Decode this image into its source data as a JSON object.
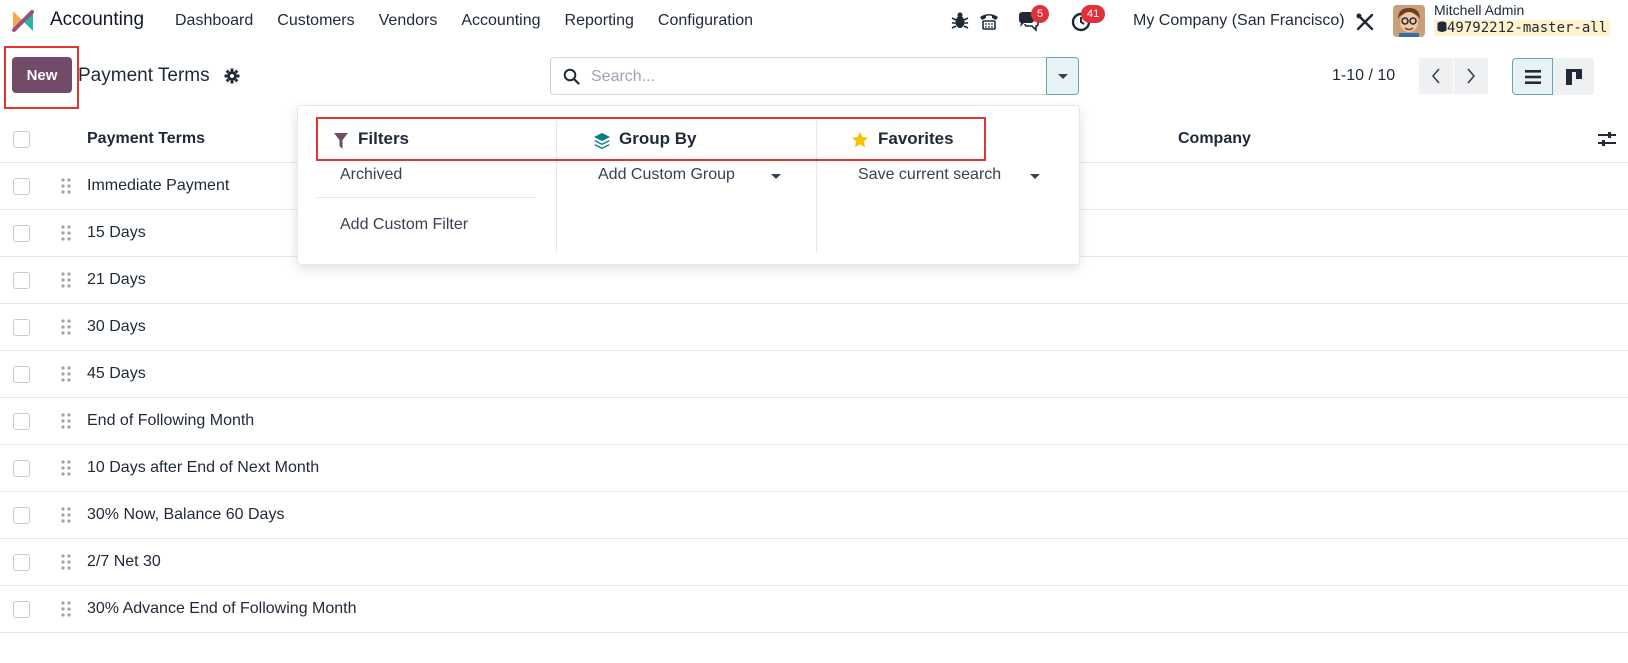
{
  "navbar": {
    "app_name": "Accounting",
    "menu": [
      "Dashboard",
      "Customers",
      "Vendors",
      "Accounting",
      "Reporting",
      "Configuration"
    ],
    "messages_count": "5",
    "activities_count": "41",
    "company": "My Company (San Francisco)",
    "user_name": "Mitchell Admin",
    "database": "49792212-master-all"
  },
  "control_panel": {
    "new_label": "New",
    "breadcrumb": "Payment Terms",
    "search_placeholder": "Search...",
    "pager": "1-10 / 10"
  },
  "search_panel": {
    "filters": {
      "title": "Filters",
      "items": [
        "Archived"
      ],
      "custom": "Add Custom Filter"
    },
    "group_by": {
      "title": "Group By",
      "custom": "Add Custom Group"
    },
    "favorites": {
      "title": "Favorites",
      "save": "Save current search"
    }
  },
  "list": {
    "columns": [
      "Payment Terms",
      "Company"
    ],
    "rows": [
      "Immediate Payment",
      "15 Days",
      "21 Days",
      "30 Days",
      "45 Days",
      "End of Following Month",
      "10 Days after End of Next Month",
      "30% Now, Balance 60 Days",
      "2/7 Net 30",
      "30% Advance End of Following Month"
    ]
  },
  "colors": {
    "primary": "#714b67",
    "badge": "#e0313a",
    "highlight": "#e3342f",
    "group_icon": "#017e84",
    "favorite_star": "#f3c200"
  }
}
